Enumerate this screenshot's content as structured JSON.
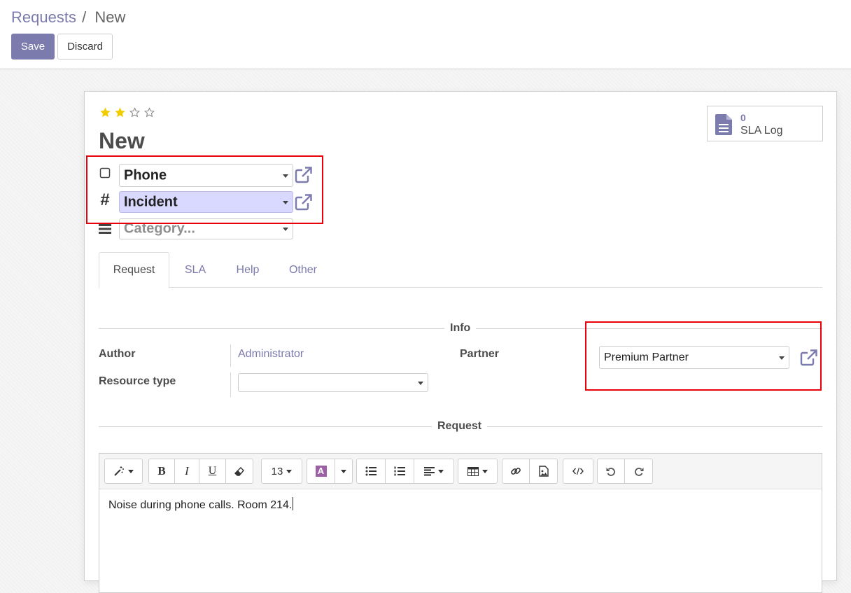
{
  "breadcrumb": {
    "parent": "Requests",
    "separator": "/",
    "current": "New"
  },
  "buttons": {
    "save": "Save",
    "discard": "Discard"
  },
  "sheet": {
    "priority_stars": {
      "filled": 2,
      "total": 4
    },
    "title": "New",
    "sla_button": {
      "count": "0",
      "label": "SLA Log"
    },
    "channel": {
      "value": "Phone",
      "icon": "square-icon"
    },
    "type": {
      "value": "Incident",
      "icon": "hash-icon"
    },
    "category": {
      "placeholder": "Category...",
      "icon": "bars-icon"
    }
  },
  "tabs": [
    "Request",
    "SLA",
    "Help",
    "Other"
  ],
  "info": {
    "title": "Info",
    "author_label": "Author",
    "author_value": "Administrator",
    "resource_type_label": "Resource type",
    "resource_type_value": "",
    "partner_label": "Partner",
    "partner_value": "Premium Partner"
  },
  "request": {
    "title": "Request",
    "toolbar": {
      "font_size": "13",
      "bold": "B",
      "italic": "I",
      "underline": "U",
      "color": "A"
    },
    "text": "Noise during phone calls. Room 214."
  },
  "colors": {
    "accent": "#7c7bad",
    "highlight": "#e8000b",
    "star": "#f3cc00",
    "incident_bg": "#d9d8ff"
  }
}
